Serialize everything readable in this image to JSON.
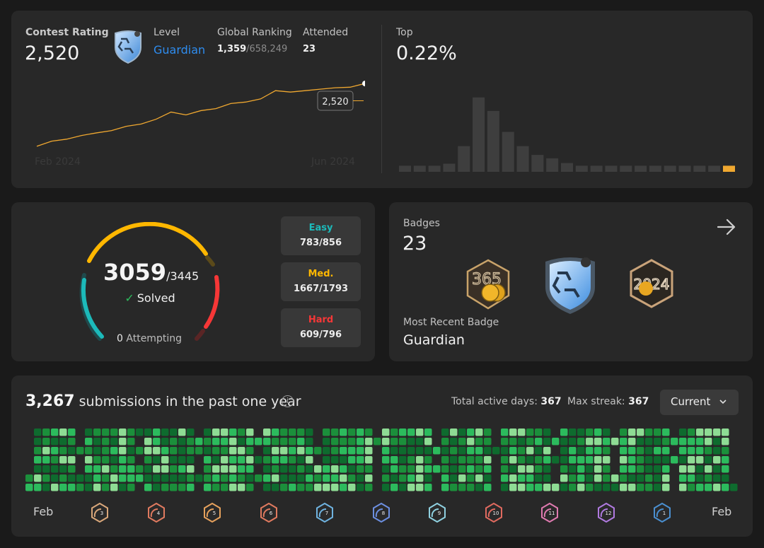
{
  "contest": {
    "rating_label": "Contest Rating",
    "rating_value": "2,520",
    "level_label": "Level",
    "level_value": "Guardian",
    "ranking_label": "Global Ranking",
    "ranking_value": "1,359",
    "ranking_total": "/658,249",
    "attended_label": "Attended",
    "attended_value": "23",
    "axis_start": "Feb 2024",
    "axis_end": "Jun 2024",
    "tooltip_value": "2,520",
    "top_label": "Top",
    "top_value": "0.22%",
    "accent_color": "#f0a830"
  },
  "chart_data": [
    {
      "type": "line",
      "title": "",
      "x": [
        "Feb 2024",
        "",
        "",
        "",
        "",
        "",
        "",
        "",
        "",
        "",
        "",
        "",
        "",
        "",
        "",
        "Jun 2024",
        "",
        "",
        "",
        "",
        "",
        "",
        ""
      ],
      "values": [
        2300,
        2318,
        2325,
        2338,
        2347,
        2355,
        2370,
        2378,
        2395,
        2420,
        2410,
        2425,
        2432,
        2450,
        2455,
        2466,
        2495,
        2490,
        2495,
        2500,
        2505,
        2507,
        2520
      ],
      "ylim": [
        2280,
        2540
      ],
      "annotation": "2,520"
    },
    {
      "type": "bar",
      "title": "",
      "values": [
        9,
        9,
        9,
        12,
        38,
        110,
        90,
        59,
        38,
        25,
        20,
        13,
        9,
        9,
        9,
        9,
        9,
        9,
        9,
        9,
        9,
        9,
        9
      ],
      "highlight_index": 22,
      "ylim": [
        0,
        115
      ]
    }
  ],
  "problems": {
    "solved": "3059",
    "total": "/3445",
    "solved_label": "Solved",
    "attempting_count": "0",
    "attempting_label": " Attempting",
    "easy_label": "Easy",
    "easy_value": "783/856",
    "easy_color": "#1cbaba",
    "medium_label": "Med.",
    "medium_value": "1667/1793",
    "medium_color": "#ffb700",
    "hard_label": "Hard",
    "hard_value": "609/796",
    "hard_color": "#f63737",
    "easy_fraction": 0.914,
    "medium_fraction": 0.93,
    "hard_fraction": 0.765
  },
  "badges": {
    "label": "Badges",
    "count": "23",
    "recent_label": "Most Recent Badge",
    "recent_value": "Guardian",
    "badge_365_text": "365",
    "badge_2024_text": "2024"
  },
  "submissions": {
    "count": "3,267",
    "text": " submissions in the past one year",
    "active_label": "Total active days: ",
    "active_value": "367",
    "streak_label": "Max streak: ",
    "streak_value": "367",
    "period": "Current",
    "month_first": "Feb",
    "month_last": "Feb",
    "month_badges": [
      "3",
      "4",
      "5",
      "6",
      "7",
      "8",
      "9",
      "10",
      "11",
      "12",
      "1"
    ]
  }
}
